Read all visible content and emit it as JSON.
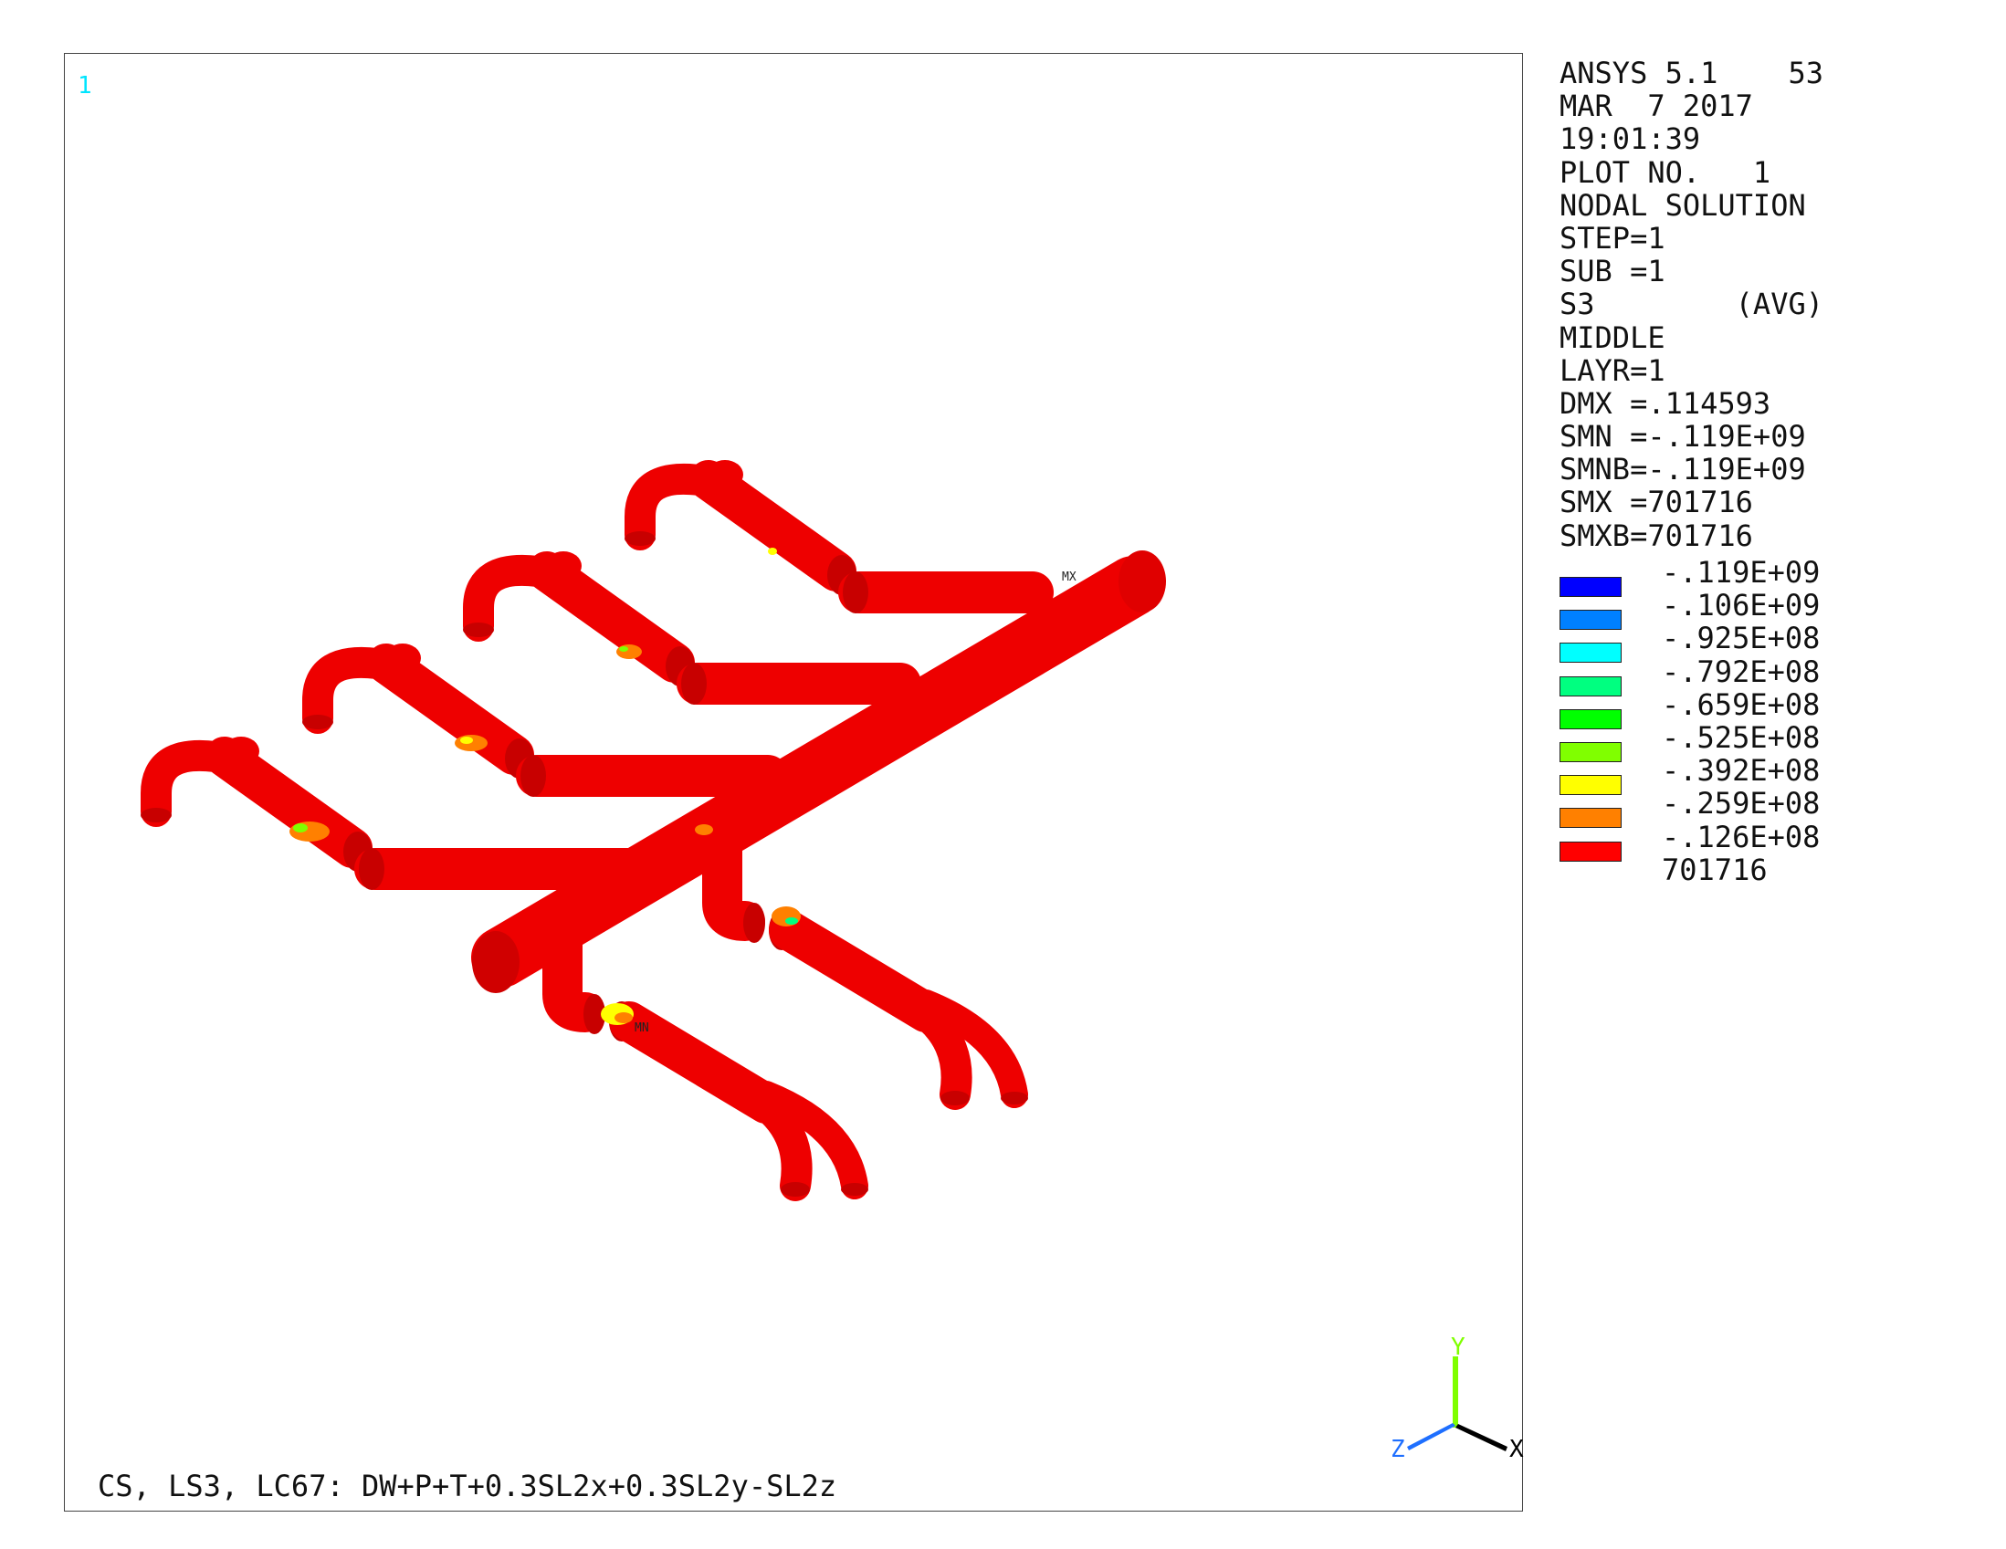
{
  "window_number": "1",
  "plot_title": "CS, LS3, LC67: DW+P+T+0.3SL2x+0.3SL2y-SL2z",
  "info_lines": [
    "ANSYS 5.1    53",
    "MAR  7 2017",
    "19:01:39",
    "PLOT NO.   1",
    "NODAL SOLUTION",
    "STEP=1",
    "SUB =1",
    "S3        (AVG)",
    "MIDDLE",
    "LAYR=1",
    "DMX =.114593",
    "SMN =-.119E+09",
    "SMNB=-.119E+09",
    "SMX =701716",
    "SMXB=701716"
  ],
  "legend": {
    "labels": [
      "-.119E+09",
      "-.106E+09",
      "-.925E+08",
      "-.792E+08",
      "-.659E+08",
      "-.525E+08",
      "-.392E+08",
      "-.259E+08",
      "-.126E+08",
      "701716"
    ],
    "colors": [
      "#0000ff",
      "#0080ff",
      "#00ffff",
      "#00ff80",
      "#00ff00",
      "#80ff00",
      "#ffff00",
      "#ff8000",
      "#ff0000"
    ]
  },
  "markers": {
    "max": "MX",
    "min": "MN"
  },
  "triad": {
    "x": "X",
    "y": "Y",
    "z": "Z",
    "x_color": "#000000",
    "y_color": "#7fff00",
    "z_color": "#1e6fff"
  },
  "pipe_color": "#ee0000"
}
